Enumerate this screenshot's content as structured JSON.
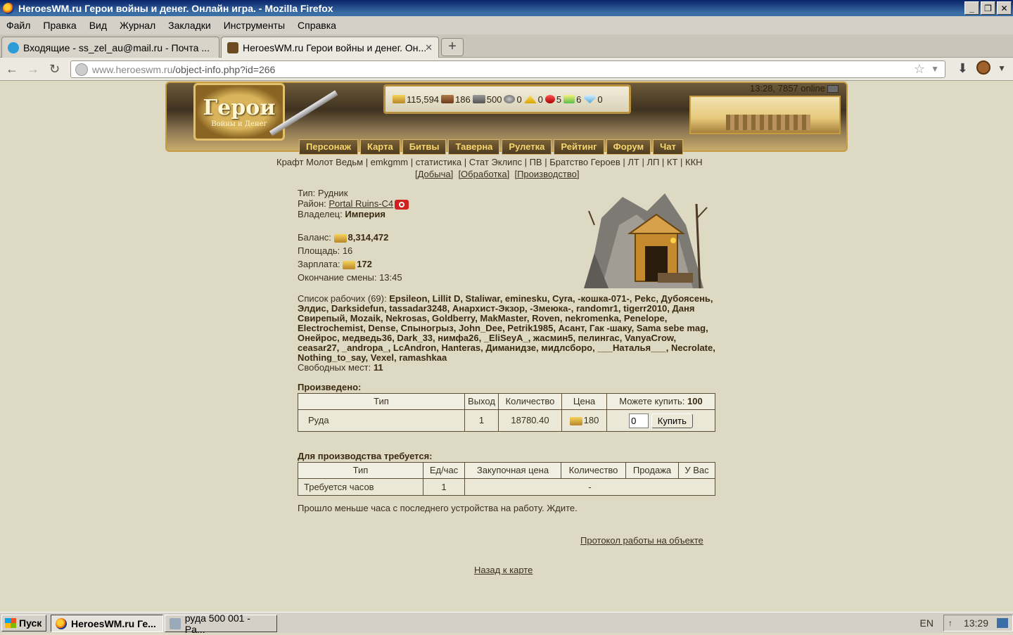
{
  "window": {
    "title": "HeroesWM.ru Герои войны и денег. Онлайн игра. - Mozilla Firefox",
    "controls": [
      "_",
      "❐",
      "✕"
    ]
  },
  "menu": [
    "Файл",
    "Правка",
    "Вид",
    "Журнал",
    "Закладки",
    "Инструменты",
    "Справка"
  ],
  "tabs": [
    {
      "label": "Входящие - ss_zel_au@mail.ru - Почта ...",
      "active": false
    },
    {
      "label": "HeroesWM.ru Герои войны и денег. Он...",
      "active": true
    }
  ],
  "url": {
    "host": "www.heroeswm.ru",
    "path": "/object-info.php?id=266"
  },
  "header": {
    "logo_line1": "Герои",
    "logo_line2": "Войны и Денег",
    "resources": [
      {
        "icon": "gold-icon",
        "value": "115,594"
      },
      {
        "icon": "wood-icon",
        "value": "186"
      },
      {
        "icon": "ore-icon",
        "value": "500"
      },
      {
        "icon": "mercury-icon",
        "value": "0"
      },
      {
        "icon": "sulfur-icon",
        "value": "0"
      },
      {
        "icon": "crystal-icon",
        "value": "5"
      },
      {
        "icon": "gem-icon",
        "value": "6"
      },
      {
        "icon": "diamond-icon",
        "value": "0"
      }
    ],
    "online": "13:28, 7857 online",
    "nav": [
      "Персонаж",
      "Карта",
      "Битвы",
      "Таверна",
      "Рулетка",
      "Рейтинг",
      "Форум",
      "Чат"
    ]
  },
  "sublinks": "Крафт Молот Ведьм | emkgmm | статистика | Стат Эклипс | ПВ | Братство Героев | ЛТ | ЛП | КТ | ККН",
  "sublinks2": [
    "[Добыча]",
    "[Обработка]",
    "[Производство]"
  ],
  "object": {
    "type_label": "Тип:",
    "type_value": "Рудник",
    "region_label": "Район:",
    "region_value": "Portal Ruins-C4",
    "owner_label": "Владелец:",
    "owner_value": "Империя",
    "balance_label": "Баланс:",
    "balance_value": "8,314,472",
    "area_label": "Площадь:",
    "area_value": "16",
    "salary_label": "Зарплата:",
    "salary_value": "172",
    "shift_label": "Окончание смены:",
    "shift_value": "13:45",
    "workers_label": "Список рабочих (69):",
    "workers": "Epsileon, Lillit D, Staliwar, eminesku, Cyra, -кошка-071-, Pekc, Дубоясень, Элдис, Darksidefun, tassadar3248, Анархист-Экзор, -Змеюка-, randomr1, tigerr2010, Даня Свирепый, Mozaik, Nekrosas, Goldberry, MakMaster, Roven, nekromenka, Penelope, Electrochemist, Dense, Спыногрыз, John_Dee, Petrik1985, Асант, Гак -шаку, Sama sebe mag, Онейрос, медведь36, Dark_33, нимфа26, _EliSeyA_, жасмин5, пелингас, VanyaCrow, ceasar27, _andropa_, LcAndron, Hanteras, Диманидзе, мидлсборо, ___Наталья___, Necrolate, Nothing_to_say, Vexel, ramashkaa",
    "free_label": "Свободных мест:",
    "free_value": "11"
  },
  "produced": {
    "title": "Произведено:",
    "headers": [
      "Тип",
      "Выход",
      "Количество",
      "Цена",
      "Можете купить:"
    ],
    "can_buy": "100",
    "row": {
      "type": "Руда",
      "output": "1",
      "quantity": "18780.40",
      "price": "180",
      "input_value": "0",
      "buy_label": "Купить"
    }
  },
  "required": {
    "title": "Для производства требуется:",
    "headers": [
      "Тип",
      "Ед/час",
      "Закупочная цена",
      "Количество",
      "Продажа",
      "У Вас"
    ],
    "row": {
      "type": "Требуется часов",
      "per_hour": "1",
      "rest": "-"
    }
  },
  "notice": "Прошло меньше часа с последнего устройства на работу. Ждите.",
  "protocol_link": "Протокол работы на объекте",
  "back_link": "Назад к карте",
  "taskbar": {
    "start": "Пуск",
    "tasks": [
      {
        "label": "HeroesWM.ru Ге...",
        "active": true
      },
      {
        "label": "руда 500 001 - Pa...",
        "active": false
      }
    ],
    "lang": "EN",
    "tray_up": "≈",
    "clock": "13:29"
  }
}
